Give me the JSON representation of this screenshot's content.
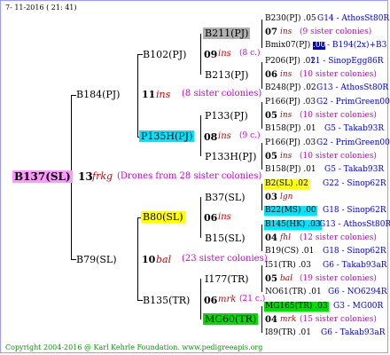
{
  "header": {
    "date": "7- 11-2016 ( 21: 41)"
  },
  "footer": {
    "text": "Copyright 2004-2016 @ Karl Kehrle Foundation.   www.pedigreeapis.org"
  },
  "colors": {
    "root_bg": "#ff99ff",
    "cyan_bg": "#00e5ff",
    "yellow_bg": "#ffff00",
    "green_bg": "#00e000",
    "gray_bg": "#b0b0b0"
  },
  "root": {
    "name": "B137(SL)",
    "num": "13",
    "sym": "frkg",
    "note": "(Drones from 28 sister colonies)"
  },
  "gen1": [
    {
      "name": "B184(PJ)",
      "num": "11",
      "sym": "ins",
      "note": "(8 sister colonies)"
    },
    {
      "name": "B79(SL)",
      "num": "10",
      "sym": "bal",
      "note": "(23 sister colonies)"
    }
  ],
  "gen2": [
    {
      "name": "B102(PJ)",
      "num": "09",
      "sym": "ins",
      "note": "(8 c.)"
    },
    {
      "name": "P135H(PJ)",
      "num": "08",
      "sym": "ins",
      "note": "(9 c.)"
    },
    {
      "name": "B80(SL)",
      "num": "06",
      "sym": "ins",
      "note": ""
    },
    {
      "name": "B135(TR)",
      "num": "06",
      "sym": "mrk",
      "note": "(21 c.)"
    }
  ],
  "gen3": [
    {
      "name": "B211(PJ)"
    },
    {
      "name": "B213(PJ)"
    },
    {
      "name": "P133(PJ)"
    },
    {
      "name": "P133H(PJ)"
    },
    {
      "name": "B37(SL)"
    },
    {
      "name": "B15(SL)"
    },
    {
      "name": "I177(TR)"
    },
    {
      "name": "MG60(TR)"
    }
  ],
  "gen4": [
    {
      "sire": "B230(PJ) .05",
      "sire_info": "G14 - AthosSt80R",
      "num": "07",
      "sym": "ins",
      "note": "(9 sister colonies)",
      "dam": "Bmix07(PJ)",
      "dam_num": ".00",
      "dam_info": "- B194(2x)+B3"
    },
    {
      "sire": "P206(PJ) .02",
      "sire_info": "11 - SinopEgg86R",
      "num": "06",
      "sym": "ins",
      "note": "(10 sister colonies)",
      "dam": "B248(PJ) .02",
      "dam_num": "",
      "dam_info": "G13 - AthosSt80R"
    },
    {
      "sire": "P166(PJ) .03",
      "sire_info": "G2 - PrimGreen00",
      "num": "05",
      "sym": "ins",
      "note": "(10 sister colonies)",
      "dam": "B158(PJ) .01",
      "dam_num": "",
      "dam_info": "G5 - Takab93R"
    },
    {
      "sire": "P166(PJ) .03",
      "sire_info": "G2 - PrimGreen00",
      "num": "05",
      "sym": "ins",
      "note": "(10 sister colonies)",
      "dam": "B158(PJ) .01",
      "dam_num": "",
      "dam_info": "G5 - Takab93R"
    },
    {
      "sire": "B2(SL) .02",
      "sire_info": "G22 - Sinop62R",
      "num": "03",
      "sym": "lgn",
      "note": "",
      "dam": "B22(MS) .00",
      "dam_num": "",
      "dam_info": "G18 - Sinop62R"
    },
    {
      "sire": "B145(HK) .03",
      "sire_info": "G13 - AthosSt80R",
      "num": "04",
      "sym": "fhl",
      "note": "(12 sister colonies)",
      "dam": "B19(CS) .01",
      "dam_num": "",
      "dam_info": "G18 - Sinop62R"
    },
    {
      "sire": "I51(TR) .03",
      "sire_info": "G6 - Takab93aR",
      "num": "05",
      "sym": "bal",
      "note": "(19 sister colonies)",
      "dam": "NO61(TR) .01",
      "dam_num": "",
      "dam_info": "G6 - NO6294R"
    },
    {
      "sire": "MG165(TR) .03",
      "sire_info": "G3 - MG00R",
      "num": "04",
      "sym": "mrk",
      "note": "(15 sister colonies)",
      "dam": "I89(TR) .01",
      "dam_num": "",
      "dam_info": "G6 - Takab93aR"
    }
  ]
}
